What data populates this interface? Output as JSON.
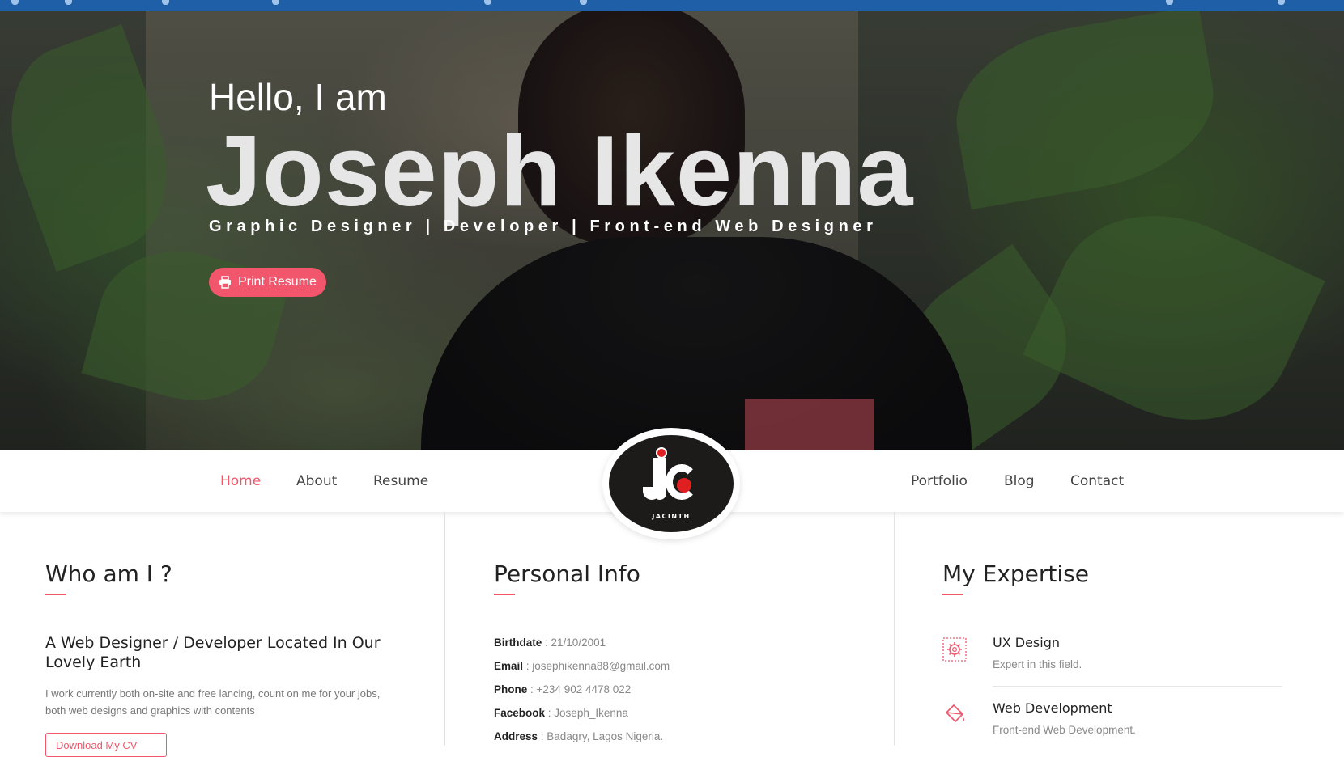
{
  "hero": {
    "greeting": "Hello, I am",
    "name": "Joseph Ikenna",
    "subtitle": "Graphic Designer | Developer | Front-end Web Designer",
    "print_button": "Print Resume"
  },
  "nav": {
    "left": [
      {
        "label": "Home",
        "active": true
      },
      {
        "label": "About",
        "active": false
      },
      {
        "label": "Resume",
        "active": false
      }
    ],
    "right": [
      {
        "label": "Portfolio"
      },
      {
        "label": "Blog"
      },
      {
        "label": "Contact"
      }
    ],
    "logo_text": "JACINTH"
  },
  "about": {
    "title": "Who am I ?",
    "headline": "A Web Designer / Developer Located In Our Lovely Earth",
    "body": "I work currently both on-site and free lancing, count on me for your jobs, both web designs and graphics with contents",
    "cv_button": "Download My CV"
  },
  "personal_info": {
    "title": "Personal Info",
    "rows": [
      {
        "key": "Birthdate",
        "value": "21/10/2001"
      },
      {
        "key": "Email",
        "value": "josephikenna88@gmail.com"
      },
      {
        "key": "Phone",
        "value": "+234 902 4478 022"
      },
      {
        "key": "Facebook",
        "value": "Joseph_Ikenna"
      },
      {
        "key": "Address",
        "value": "Badagry, Lagos Nigeria."
      }
    ]
  },
  "expertise": {
    "title": "My Expertise",
    "items": [
      {
        "title": "UX Design",
        "desc": "Expert in this field.",
        "icon": "gear-icon"
      },
      {
        "title": "Web Development",
        "desc": "Front-end Web Development.",
        "icon": "paint-bucket-icon"
      }
    ]
  },
  "colors": {
    "accent": "#f1566c",
    "text_dark": "#222222",
    "text_muted": "#888888",
    "browser_bar": "#1f5fa8"
  }
}
